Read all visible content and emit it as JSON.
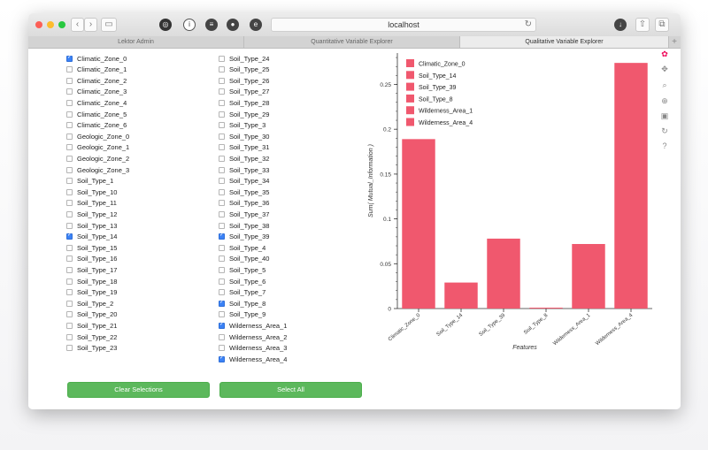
{
  "browser": {
    "url": "localhost",
    "tabs": [
      {
        "label": "Lektor Admin",
        "active": false
      },
      {
        "label": "Quantitative Variable Explorer",
        "active": false
      },
      {
        "label": "Qualitative Variable Explorer",
        "active": true
      }
    ],
    "new_tab": "+",
    "icons": [
      "back-icon",
      "forward-icon",
      "sidebar-icon",
      "extension-icon",
      "info-icon",
      "layers-icon",
      "adblock-icon",
      "evernote-icon",
      "download-icon",
      "share-icon",
      "tabs-icon",
      "reload-icon"
    ]
  },
  "features": {
    "column1": [
      {
        "label": "Climatic_Zone_0",
        "checked": true
      },
      {
        "label": "Climatic_Zone_1",
        "checked": false
      },
      {
        "label": "Climatic_Zone_2",
        "checked": false
      },
      {
        "label": "Climatic_Zone_3",
        "checked": false
      },
      {
        "label": "Climatic_Zone_4",
        "checked": false
      },
      {
        "label": "Climatic_Zone_5",
        "checked": false
      },
      {
        "label": "Climatic_Zone_6",
        "checked": false
      },
      {
        "label": "Geologic_Zone_0",
        "checked": false
      },
      {
        "label": "Geologic_Zone_1",
        "checked": false
      },
      {
        "label": "Geologic_Zone_2",
        "checked": false
      },
      {
        "label": "Geologic_Zone_3",
        "checked": false
      },
      {
        "label": "Soil_Type_1",
        "checked": false
      },
      {
        "label": "Soil_Type_10",
        "checked": false
      },
      {
        "label": "Soil_Type_11",
        "checked": false
      },
      {
        "label": "Soil_Type_12",
        "checked": false
      },
      {
        "label": "Soil_Type_13",
        "checked": false
      },
      {
        "label": "Soil_Type_14",
        "checked": true
      },
      {
        "label": "Soil_Type_15",
        "checked": false
      },
      {
        "label": "Soil_Type_16",
        "checked": false
      },
      {
        "label": "Soil_Type_17",
        "checked": false
      },
      {
        "label": "Soil_Type_18",
        "checked": false
      },
      {
        "label": "Soil_Type_19",
        "checked": false
      },
      {
        "label": "Soil_Type_2",
        "checked": false
      },
      {
        "label": "Soil_Type_20",
        "checked": false
      },
      {
        "label": "Soil_Type_21",
        "checked": false
      },
      {
        "label": "Soil_Type_22",
        "checked": false
      },
      {
        "label": "Soil_Type_23",
        "checked": false
      }
    ],
    "column2": [
      {
        "label": "Soil_Type_24",
        "checked": false
      },
      {
        "label": "Soil_Type_25",
        "checked": false
      },
      {
        "label": "Soil_Type_26",
        "checked": false
      },
      {
        "label": "Soil_Type_27",
        "checked": false
      },
      {
        "label": "Soil_Type_28",
        "checked": false
      },
      {
        "label": "Soil_Type_29",
        "checked": false
      },
      {
        "label": "Soil_Type_3",
        "checked": false
      },
      {
        "label": "Soil_Type_30",
        "checked": false
      },
      {
        "label": "Soil_Type_31",
        "checked": false
      },
      {
        "label": "Soil_Type_32",
        "checked": false
      },
      {
        "label": "Soil_Type_33",
        "checked": false
      },
      {
        "label": "Soil_Type_34",
        "checked": false
      },
      {
        "label": "Soil_Type_35",
        "checked": false
      },
      {
        "label": "Soil_Type_36",
        "checked": false
      },
      {
        "label": "Soil_Type_37",
        "checked": false
      },
      {
        "label": "Soil_Type_38",
        "checked": false
      },
      {
        "label": "Soil_Type_39",
        "checked": true
      },
      {
        "label": "Soil_Type_4",
        "checked": false
      },
      {
        "label": "Soil_Type_40",
        "checked": false
      },
      {
        "label": "Soil_Type_5",
        "checked": false
      },
      {
        "label": "Soil_Type_6",
        "checked": false
      },
      {
        "label": "Soil_Type_7",
        "checked": false
      },
      {
        "label": "Soil_Type_8",
        "checked": true
      },
      {
        "label": "Soil_Type_9",
        "checked": false
      },
      {
        "label": "Wilderness_Area_1",
        "checked": true
      },
      {
        "label": "Wilderness_Area_2",
        "checked": false
      },
      {
        "label": "Wilderness_Area_3",
        "checked": false
      },
      {
        "label": "Wilderness_Area_4",
        "checked": true
      }
    ]
  },
  "buttons": {
    "clear": "Clear Selections",
    "select_all": "Select All"
  },
  "plot_tools": [
    "bokeh-logo-icon",
    "pan-icon",
    "box-zoom-icon",
    "wheel-zoom-icon",
    "save-icon",
    "reset-icon",
    "help-icon"
  ],
  "chart_data": {
    "type": "bar",
    "categories": [
      "Climatic_Zone_0",
      "Soil_Type_14",
      "Soil_Type_39",
      "Soil_Type_8",
      "Wilderness_Area_1",
      "Wilderness_Area_4"
    ],
    "values": [
      0.189,
      0.029,
      0.078,
      0.001,
      0.072,
      0.274
    ],
    "xlabel": "Features",
    "ylabel": "Sum( Mutual_Information )",
    "yticks": [
      "0",
      "0.05",
      "0.1",
      "0.15",
      "0.2",
      "0.25"
    ],
    "ylim": [
      0,
      0.285
    ],
    "legend_placement": "top-left",
    "bar_color": "#f0586e",
    "grid": false
  }
}
